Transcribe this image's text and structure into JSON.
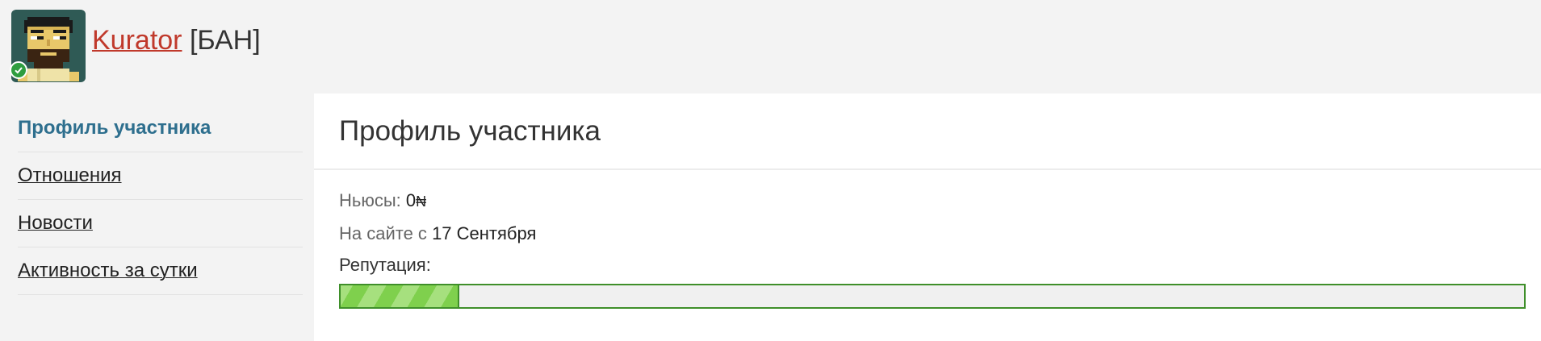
{
  "user": {
    "name": "Kurator",
    "ban_tag": "[БАН]"
  },
  "sidebar": {
    "items": [
      {
        "label": "Профиль участника",
        "active": true
      },
      {
        "label": "Отношения",
        "active": false
      },
      {
        "label": "Новости",
        "active": false
      },
      {
        "label": "Активность за сутки",
        "active": false
      }
    ]
  },
  "main": {
    "title": "Профиль участника",
    "newsy_label": "Ньюсы:",
    "newsy_value": "0",
    "newsy_currency": "₦",
    "since_label": "На сайте с",
    "since_value": "17 Сентября",
    "reputation_label": "Репутация:",
    "reputation_fraction": 0.1
  },
  "colors": {
    "link": "#c0392b",
    "active_nav": "#2e6f8e",
    "rep_green": "#7fd04d",
    "rep_border": "#3f8f2a"
  },
  "icons": {
    "avatar": "pixel-art-avatar",
    "online": "check-circle-icon"
  }
}
